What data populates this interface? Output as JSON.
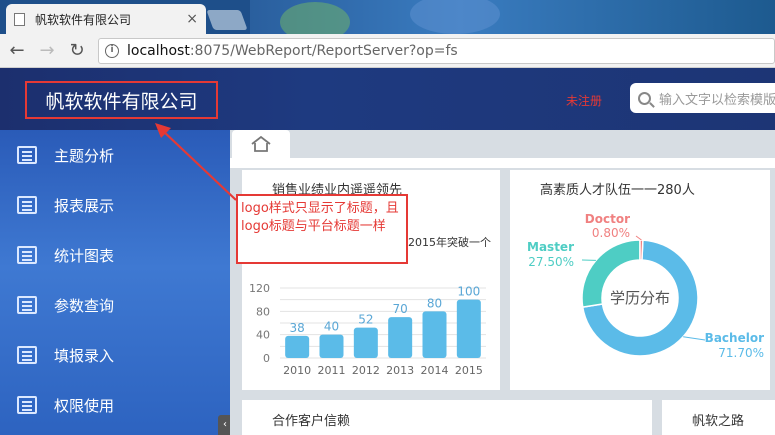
{
  "browser": {
    "tab_title": "帆软软件有限公司",
    "tab_close": "×",
    "url_host": "localhost",
    "url_rest": ":8075/WebReport/ReportServer?op=fs"
  },
  "header": {
    "logo_title": "帆软软件有限公司",
    "red_badge": "未注册",
    "search_placeholder": "输入文字以检索模版"
  },
  "sidebar": {
    "items": [
      {
        "label": "主题分析"
      },
      {
        "label": "报表展示"
      },
      {
        "label": "统计图表"
      },
      {
        "label": "参数查询"
      },
      {
        "label": "填报录入"
      },
      {
        "label": "权限使用"
      }
    ]
  },
  "annotation": {
    "text": "logo样式只显示了标题，且logo标题与平台标题一样"
  },
  "panels": {
    "sales": {
      "title": "销售业绩业内遥遥领先",
      "subtitle": "2015年突破一个"
    },
    "talent": {
      "title": "高素质人才队伍一一280人",
      "center_label": "学历分布"
    },
    "clients": {
      "title": "合作客户信赖"
    },
    "road": {
      "title": "帆软之路"
    }
  },
  "colors": {
    "bar": "#5bbbe8",
    "bachelor": "#5bbbe8",
    "master": "#4ecdc4",
    "doctor": "#f08080"
  },
  "chart_data": [
    {
      "type": "bar",
      "categories": [
        "2010",
        "2011",
        "2012",
        "2013",
        "2014",
        "2015"
      ],
      "values": [
        38,
        40,
        52,
        70,
        80,
        100
      ],
      "ylim": [
        0,
        120
      ],
      "yticks": [
        0,
        20,
        40,
        60,
        80,
        100,
        120
      ],
      "ytick_labels": [
        "0",
        "40",
        "80",
        "120"
      ],
      "title": "销售业绩业内遥遥领先"
    },
    {
      "type": "pie",
      "labels": [
        "Bachelor",
        "Master",
        "Doctor"
      ],
      "values": [
        71.7,
        27.5,
        0.8
      ],
      "value_labels": [
        "71.70%",
        "27.50%",
        "0.80%"
      ],
      "center_label": "学历分布",
      "title": "高素质人才队伍一一280人"
    }
  ]
}
